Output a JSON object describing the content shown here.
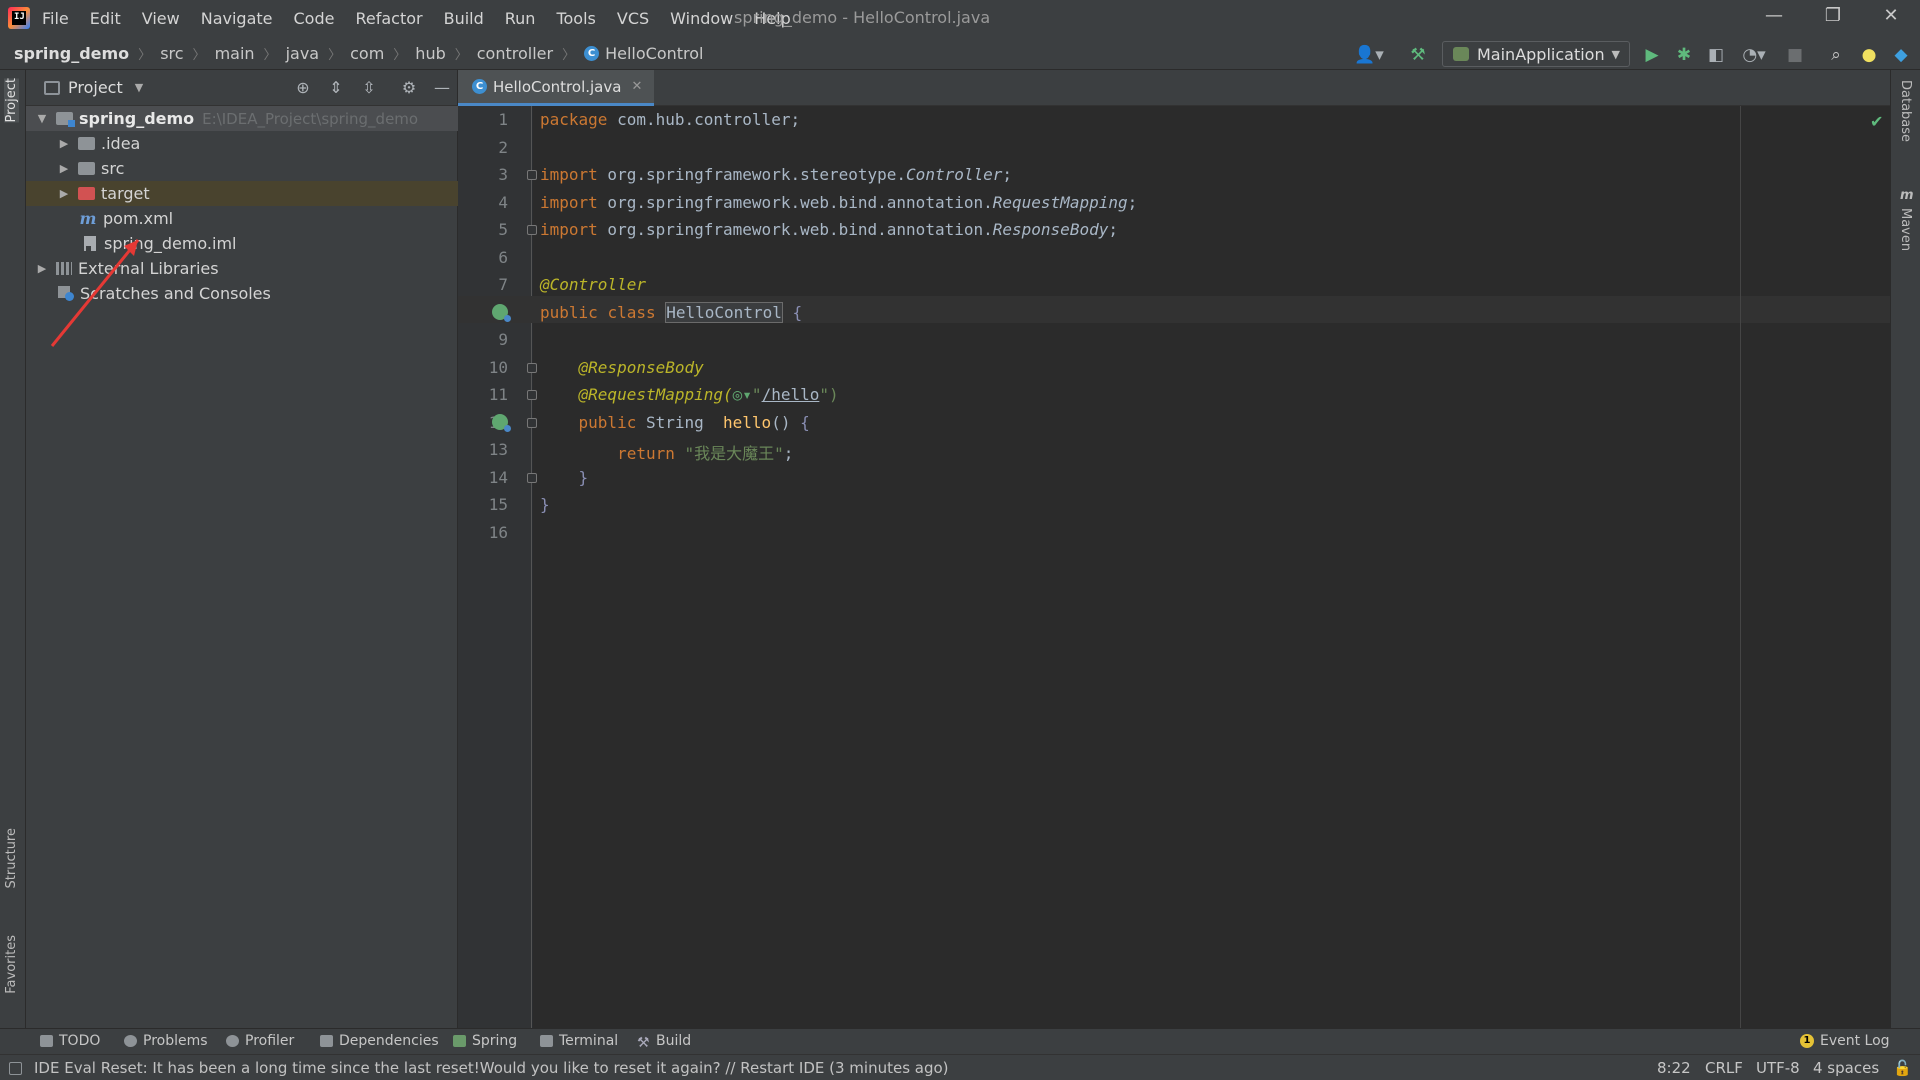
{
  "window": {
    "title": "spring_demo - HelloControl.java",
    "app_icon_text": "IJ",
    "controls": {
      "minimize": "—",
      "restore": "❐",
      "close": "✕"
    }
  },
  "menu": [
    "File",
    "Edit",
    "View",
    "Navigate",
    "Code",
    "Refactor",
    "Build",
    "Run",
    "Tools",
    "VCS",
    "Window",
    "Help"
  ],
  "breadcrumb": [
    "spring_demo",
    "src",
    "main",
    "java",
    "com",
    "hub",
    "controller",
    "HelloControl"
  ],
  "breadcrumb_sep": "〉",
  "toolbar": {
    "run_config": "MainApplication",
    "icons": [
      "user-icon",
      "hammer-icon",
      "run-icon",
      "debug-icon",
      "coverage-icon",
      "profile-icon",
      "stop-icon",
      "search-icon",
      "update-icon",
      "toolbox-icon"
    ]
  },
  "left_strip": {
    "tabs": [
      "Project",
      "Structure",
      "Favorites"
    ]
  },
  "right_strip": {
    "tabs": [
      "Database",
      "Maven"
    ],
    "maven_letter": "m"
  },
  "project_panel": {
    "title": "Project",
    "root_name": "spring_demo",
    "root_path": "E:\\IDEA_Project\\spring_demo",
    "items": [
      {
        "label": ".idea"
      },
      {
        "label": "src"
      },
      {
        "label": "target"
      },
      {
        "label": "pom.xml"
      },
      {
        "label": "spring_demo.iml"
      },
      {
        "label": "External Libraries"
      },
      {
        "label": "Scratches and Consoles"
      }
    ],
    "maven_glyph": "m"
  },
  "editor": {
    "tab_label": "HelloControl.java",
    "tab_close": "✕",
    "line_numbers": [
      "1",
      "2",
      "3",
      "4",
      "5",
      "6",
      "7",
      "8",
      "9",
      "10",
      "11",
      "12",
      "13",
      "14",
      "15",
      "16"
    ],
    "code": {
      "l1_kw": "package",
      "l1_rest": " com.hub.controller;",
      "imp_kw": "import",
      "l3_pkg": " org.springframework.stereotype.",
      "l3_cls": "Controller",
      "l4_pkg": " org.springframework.web.bind.annotation.",
      "l4_cls": "RequestMapping",
      "l5_pkg": " org.springframework.web.bind.annotation.",
      "l5_cls": "ResponseBody",
      "semi": ";",
      "l7_ann": "@Controller",
      "l8_public": "public",
      "l8_class": "class",
      "l8_name": "HelloControl",
      "open_brace": "{",
      "close_brace": "}",
      "l10_ann": "@ResponseBody",
      "l11_ann": "@RequestMapping(",
      "l11_quote": "\"",
      "l11_url": "/hello",
      "l11_end": "\")",
      "l12_public": "public",
      "l12_type": " String ",
      "l12_method": " hello",
      "l12_parens": "() ",
      "l13_return": "return",
      "l13_str": " \"我是大魔王\"",
      "l13_semi": ";"
    }
  },
  "bottom_tabs": [
    "TODO",
    "Problems",
    "Profiler",
    "Dependencies",
    "Spring",
    "Terminal",
    "Build"
  ],
  "event_log": {
    "label": "Event Log",
    "count": "1"
  },
  "status_bar": {
    "message": "IDE Eval Reset: It has been a long time since the last reset!Would you like to reset it again? // Restart IDE (3 minutes ago)",
    "position": "8:22",
    "line_sep": "CRLF",
    "encoding": "UTF-8",
    "indent": "4 spaces"
  },
  "colors": {
    "accent": "#4a88c7",
    "annotation_arrow": "#e53935"
  }
}
